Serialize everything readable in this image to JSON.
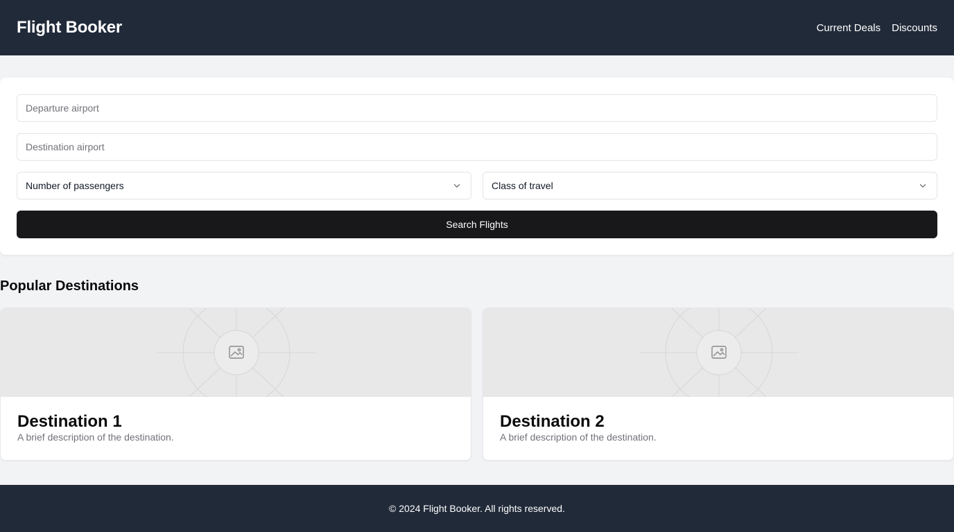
{
  "header": {
    "title": "Flight Booker",
    "nav": [
      {
        "label": "Current Deals"
      },
      {
        "label": "Discounts"
      }
    ]
  },
  "search": {
    "departure_placeholder": "Departure airport",
    "destination_placeholder": "Destination airport",
    "passengers_label": "Number of passengers",
    "class_label": "Class of travel",
    "submit_label": "Search Flights"
  },
  "destinations": {
    "heading": "Popular Destinations",
    "items": [
      {
        "name": "Destination 1",
        "description": "A brief description of the destination.",
        "image_icon": "image-placeholder-icon"
      },
      {
        "name": "Destination 2",
        "description": "A brief description of the destination.",
        "image_icon": "image-placeholder-icon"
      }
    ]
  },
  "footer": {
    "text": "© 2024 Flight Booker. All rights reserved."
  },
  "colors": {
    "header_bg": "#212a39",
    "page_bg": "#f2f3f5",
    "button_bg": "#18181b",
    "muted_text": "#71717a"
  }
}
